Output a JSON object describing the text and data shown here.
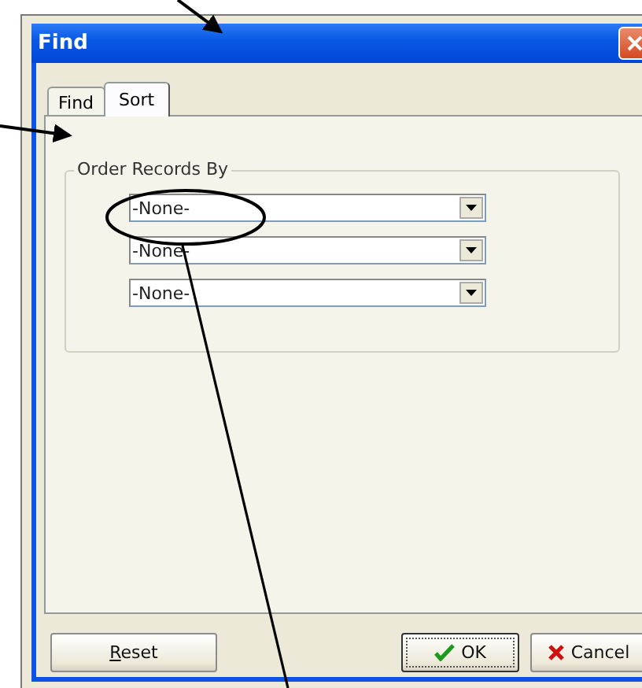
{
  "window": {
    "title": "Find"
  },
  "tabs": [
    {
      "label": "Find",
      "selected": false
    },
    {
      "label": "Sort",
      "selected": true
    }
  ],
  "group": {
    "label": "Order Records By",
    "sort_fields": [
      {
        "value": "-None-"
      },
      {
        "value": "-None-"
      },
      {
        "value": "-None-"
      }
    ]
  },
  "buttons": [
    {
      "label": "Reset",
      "kind": "plain",
      "first_letter_underlined": true,
      "default": false
    },
    {
      "label": "OK",
      "kind": "ok",
      "default": true
    },
    {
      "label": "Cancel",
      "kind": "cancel",
      "default": false
    }
  ]
}
